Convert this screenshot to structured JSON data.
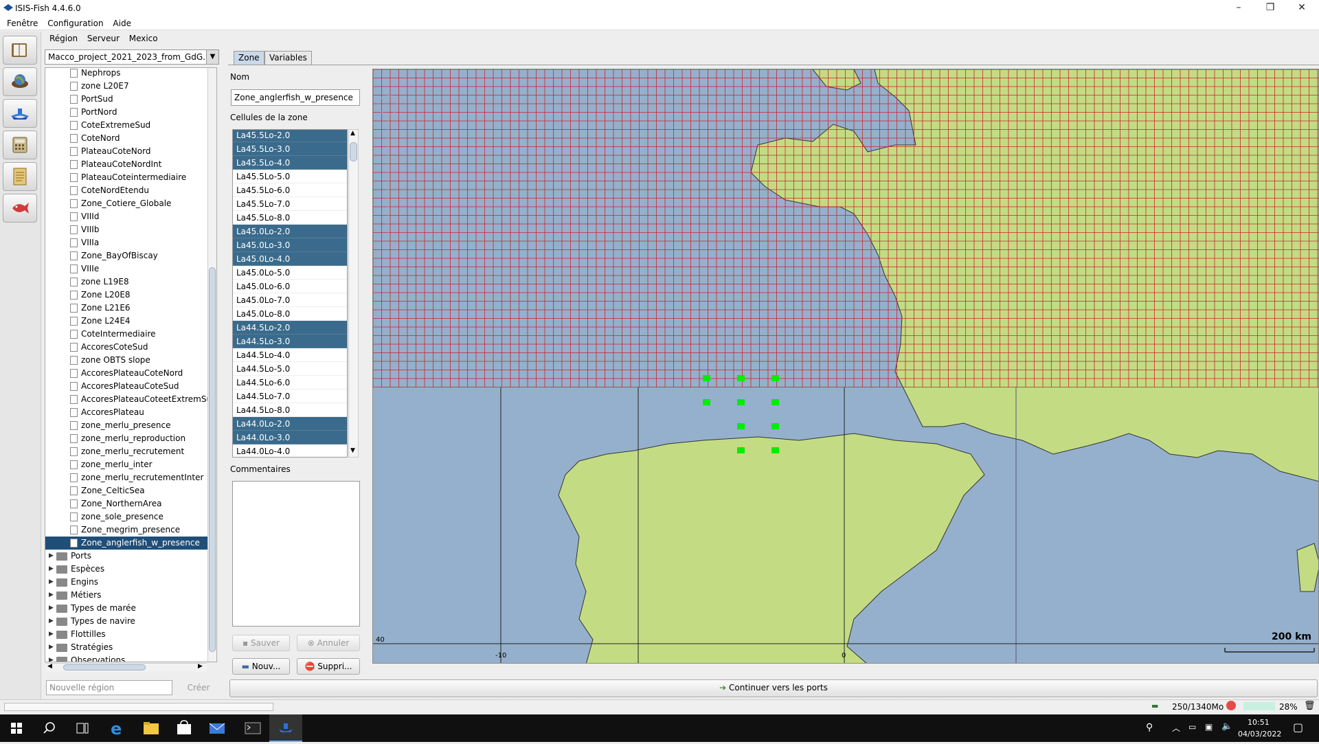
{
  "window": {
    "title": "ISIS-Fish 4.4.6.0",
    "controls": [
      "–",
      "❐",
      "✕"
    ]
  },
  "menu": [
    "Fenêtre",
    "Configuration",
    "Aide"
  ],
  "submenu": [
    "Région",
    "Serveur",
    "Mexico"
  ],
  "leftbar_icons": [
    "book-icon",
    "globe-icon",
    "ship-icon",
    "calculator-icon",
    "notes-icon",
    "fish-icon"
  ],
  "region_select": "Macco_project_2021_2023_from_GdG...",
  "tree": {
    "zones": [
      "Nephrops",
      "zone L20E7",
      "PortSud",
      "PortNord",
      "CoteExtremeSud",
      "CoteNord",
      "PlateauCoteNord",
      "PlateauCoteNordInt",
      "PlateauCoteintermediaire",
      "CoteNordEtendu",
      "Zone_Cotiere_Globale",
      "VIIId",
      "VIIIb",
      "VIIIa",
      "Zone_BayOfBiscay",
      "VIIIe",
      "zone L19E8",
      "Zone L20E8",
      "Zone L21E6",
      "Zone L24E4",
      "CoteIntermediaire",
      "AccoresCoteSud",
      "zone OBTS slope",
      "AccoresPlateauCoteNord",
      "AccoresPlateauCoteSud",
      "AccoresPlateauCoteetExtremSud",
      "AccoresPlateau",
      "zone_merlu_presence",
      "zone_merlu_reproduction",
      "zone_merlu_recrutement",
      "zone_merlu_inter",
      "zone_merlu_recrutementInter",
      "Zone_CelticSea",
      "Zone_NorthernArea",
      "zone_sole_presence",
      "Zone_megrim_presence",
      "Zone_anglerfish_w_presence"
    ],
    "selected": "Zone_anglerfish_w_presence",
    "folders": [
      "Ports",
      "Espèces",
      "Engins",
      "Métiers",
      "Types de marée",
      "Types de navire",
      "Flottilles",
      "Stratégies",
      "Observations"
    ]
  },
  "new_region": {
    "placeholder": "Nouvelle région",
    "create_label": "Créer"
  },
  "tabs": [
    "Zone",
    "Variables"
  ],
  "zone": {
    "nom_label": "Nom",
    "nom_value": "Zone_anglerfish_w_presence",
    "cells_label": "Cellules de la zone",
    "cells": [
      {
        "name": "La45.5Lo-2.0",
        "sel": true
      },
      {
        "name": "La45.5Lo-3.0",
        "sel": true
      },
      {
        "name": "La45.5Lo-4.0",
        "sel": true
      },
      {
        "name": "La45.5Lo-5.0",
        "sel": false
      },
      {
        "name": "La45.5Lo-6.0",
        "sel": false
      },
      {
        "name": "La45.5Lo-7.0",
        "sel": false
      },
      {
        "name": "La45.5Lo-8.0",
        "sel": false
      },
      {
        "name": "La45.0Lo-2.0",
        "sel": true
      },
      {
        "name": "La45.0Lo-3.0",
        "sel": true
      },
      {
        "name": "La45.0Lo-4.0",
        "sel": true
      },
      {
        "name": "La45.0Lo-5.0",
        "sel": false
      },
      {
        "name": "La45.0Lo-6.0",
        "sel": false
      },
      {
        "name": "La45.0Lo-7.0",
        "sel": false
      },
      {
        "name": "La45.0Lo-8.0",
        "sel": false
      },
      {
        "name": "La44.5Lo-2.0",
        "sel": true
      },
      {
        "name": "La44.5Lo-3.0",
        "sel": true
      },
      {
        "name": "La44.5Lo-4.0",
        "sel": false
      },
      {
        "name": "La44.5Lo-5.0",
        "sel": false
      },
      {
        "name": "La44.5Lo-6.0",
        "sel": false
      },
      {
        "name": "La44.5Lo-7.0",
        "sel": false
      },
      {
        "name": "La44.5Lo-8.0",
        "sel": false
      },
      {
        "name": "La44.0Lo-2.0",
        "sel": true
      },
      {
        "name": "La44.0Lo-3.0",
        "sel": true
      },
      {
        "name": "La44.0Lo-4.0",
        "sel": false
      }
    ],
    "comments_label": "Commentaires",
    "buttons": {
      "save": "Sauver",
      "cancel": "Annuler",
      "new": "Nouv...",
      "delete": "Suppri..."
    }
  },
  "map": {
    "scale_label": "200 km",
    "lat_label": "40",
    "lon_labels": [
      "-10",
      "0"
    ],
    "colors": {
      "sea": "#95b0cc",
      "land": "#c3dc83",
      "grid": "#d0202e",
      "selected_cell": "#00ee00"
    }
  },
  "continue_button": "Continuer vers les ports",
  "status": {
    "memory": "250/1340Mo",
    "cpu": "28%"
  },
  "taskbar": {
    "time": "10:51",
    "date": "04/03/2022"
  }
}
